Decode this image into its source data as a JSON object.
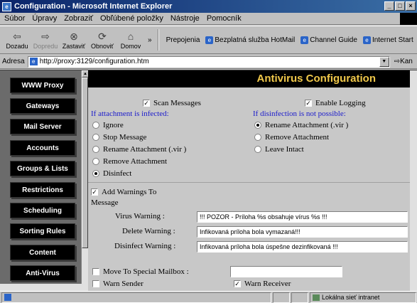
{
  "window": {
    "title": "Configuration - Microsoft Internet Explorer",
    "buttons": [
      "_",
      "□",
      "×"
    ]
  },
  "menu": [
    "Súbor",
    "Úpravy",
    "Zobraziť",
    "Obľúbené položky",
    "Nástroje",
    "Pomocník"
  ],
  "toolbar": {
    "back": "Dozadu",
    "forward": "Dopredu",
    "stop": "Zastaviť",
    "refresh": "Obnoviť",
    "home": "Domov",
    "chevron": "»"
  },
  "links": [
    "Prepojenia",
    "Bezplatná služba HotMail",
    "Channel Guide",
    "Internet Start"
  ],
  "address": {
    "label": "Adresa",
    "url": "http://proxy:3129/configuration.htm",
    "go_label": "Kan"
  },
  "sidebar": {
    "items": [
      "WWW Proxy",
      "Gateways",
      "Mail Server",
      "Accounts",
      "Groups & Lists",
      "Restrictions",
      "Scheduling",
      "Sorting Rules",
      "Content",
      "Anti-Virus"
    ]
  },
  "main": {
    "title": "Antivirus Configuration",
    "scan_messages": {
      "label": "Scan Messages",
      "checked": true
    },
    "enable_logging": {
      "label": "Enable Logging",
      "checked": true
    },
    "infected_heading": "If attachment is infected:",
    "infected_options": [
      {
        "label": "Ignore",
        "selected": false
      },
      {
        "label": "Stop Message",
        "selected": false
      },
      {
        "label": "Rename Attachment (.vir )",
        "selected": false
      },
      {
        "label": "Remove Attachment",
        "selected": false
      },
      {
        "label": "Disinfect",
        "selected": true
      }
    ],
    "disinfect_heading": "If disinfection is not possible:",
    "disinfect_options": [
      {
        "label": "Rename Attachment (.vir )",
        "selected": true
      },
      {
        "label": "Remove Attachment",
        "selected": false
      },
      {
        "label": "Leave Intact",
        "selected": false
      }
    ],
    "add_warnings": {
      "label_line1": "Add Warnings To",
      "label_line2": "Message",
      "checked": true
    },
    "virus_warning": {
      "label": "Virus Warning :",
      "value": "!!! POZOR - Príloha %s obsahuje vírus %s !!!"
    },
    "delete_warning": {
      "label": "Delete Warning :",
      "value": "Infikovaná príloha bola vymazaná!!!"
    },
    "disinfect_warning": {
      "label": "Disinfect Warning :",
      "value": "Infikovaná príloha bola úspešne dezinfikovaná !!!"
    },
    "move_mailbox": {
      "label": "Move To Special Mailbox :",
      "checked": false,
      "value": ""
    },
    "warn_sender": {
      "label": "Warn Sender",
      "checked": false
    },
    "warn_receiver": {
      "label": "Warn Receiver",
      "checked": true
    }
  },
  "status": {
    "zone": "Lokálna sieť intranet"
  }
}
